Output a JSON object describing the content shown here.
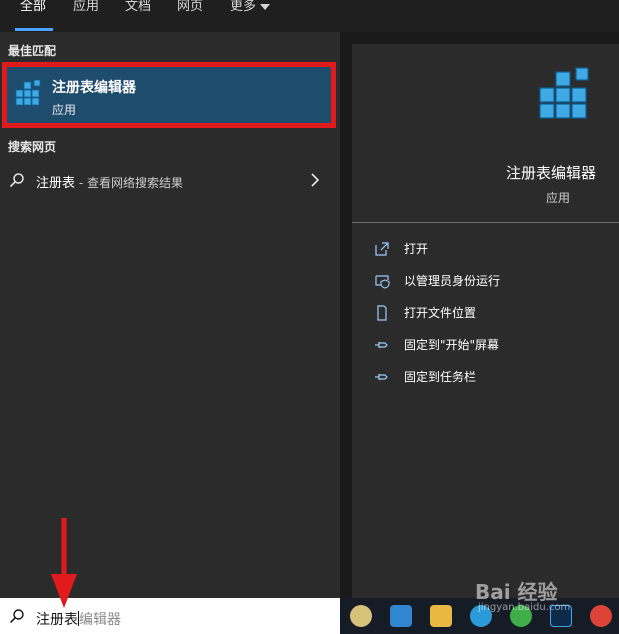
{
  "tabs": [
    {
      "label": "全部",
      "active": true
    },
    {
      "label": "应用"
    },
    {
      "label": "文档"
    },
    {
      "label": "网页"
    },
    {
      "label": "更多"
    }
  ],
  "left": {
    "best_match_title": "最佳匹配",
    "best_match": {
      "title": "注册表编辑器",
      "subtitle": "应用",
      "icon": "registry-editor-icon"
    },
    "web_search_title": "搜索网页",
    "web_result": {
      "query": "注册表",
      "suffix": " - 查看网络搜索结果"
    }
  },
  "detail": {
    "app_name": "注册表编辑器",
    "app_kind": "应用",
    "actions": [
      {
        "label": "打开",
        "icon": "open-icon"
      },
      {
        "label": "以管理员身份运行",
        "icon": "admin-shield-icon"
      },
      {
        "label": "打开文件位置",
        "icon": "file-location-icon"
      },
      {
        "label": "固定到\"开始\"屏幕",
        "icon": "pin-icon"
      },
      {
        "label": "固定到任务栏",
        "icon": "pin-icon"
      }
    ]
  },
  "search": {
    "typed": "注册表",
    "completion": "编辑器"
  },
  "watermark": {
    "brand": "Bai 经验",
    "url": "jingyan.baidu.com"
  },
  "colors": {
    "accent": "#4aa3ff",
    "highlight_border": "#e11b1b",
    "selected_bg": "#1e4c6d",
    "annotation_arrow": "#e11b1b"
  }
}
